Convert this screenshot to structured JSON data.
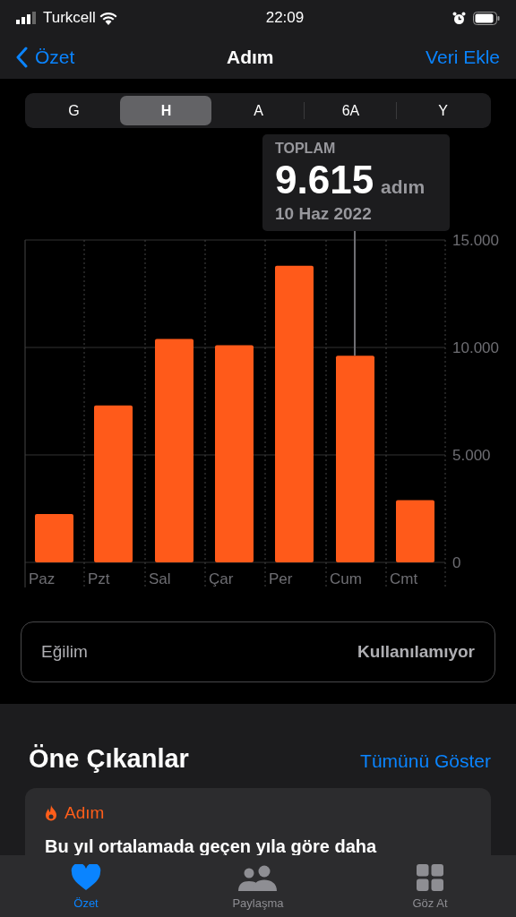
{
  "status_bar": {
    "carrier": "Turkcell",
    "time": "22:09"
  },
  "nav": {
    "back": "Özet",
    "title": "Adım",
    "action": "Veri Ekle"
  },
  "segments": [
    {
      "label": "G",
      "selected": false
    },
    {
      "label": "H",
      "selected": true
    },
    {
      "label": "A",
      "selected": false
    },
    {
      "label": "6A",
      "selected": false
    },
    {
      "label": "Y",
      "selected": false
    }
  ],
  "summary": {
    "label": "TOPLAM",
    "value": "9.615",
    "unit": "adım",
    "date": "10 Haz 2022"
  },
  "chart_data": {
    "type": "bar",
    "categories": [
      "Paz",
      "Pzt",
      "Sal",
      "Çar",
      "Per",
      "Cum",
      "Cmt"
    ],
    "values": [
      2250,
      7300,
      10400,
      10100,
      13800,
      9615,
      2900
    ],
    "ylim": [
      0,
      15000
    ],
    "yticks": [
      {
        "value": 0,
        "label": "0"
      },
      {
        "value": 5000,
        "label": "5.000"
      },
      {
        "value": 10000,
        "label": "10.000"
      },
      {
        "value": 15000,
        "label": "15.000"
      }
    ],
    "annotations": [
      {
        "x": "Cum"
      }
    ]
  },
  "trend": {
    "label": "Eğilim",
    "value": "Kullanılamıyor"
  },
  "highlights": {
    "title": "Öne Çıkanlar",
    "link": "Tümünü Göster",
    "cards": [
      {
        "category": "Adım",
        "text": "Bu yıl ortalamada geçen yıla göre daha"
      }
    ]
  },
  "tab_bar": [
    {
      "label": "Özet",
      "kind": "heart",
      "selected": true
    },
    {
      "label": "Paylaşma",
      "kind": "people",
      "selected": false
    },
    {
      "label": "Göz At",
      "kind": "grid",
      "selected": false
    }
  ]
}
